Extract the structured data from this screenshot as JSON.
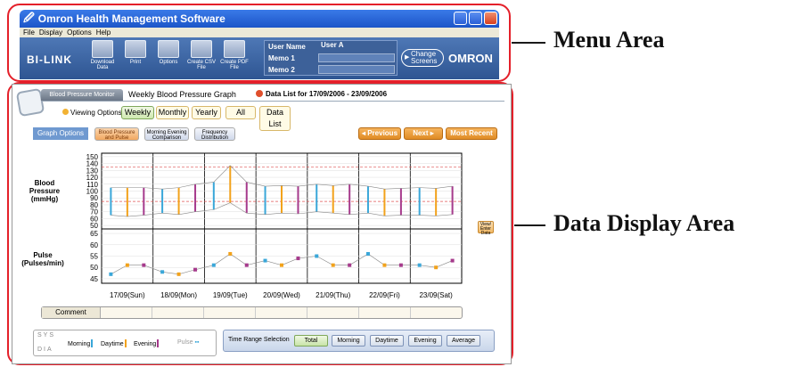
{
  "window": {
    "title": "Omron Health Management Software"
  },
  "menu": {
    "items": [
      "File",
      "Display",
      "Options",
      "Help"
    ]
  },
  "toolbar": {
    "logo": "BI-LINK",
    "buttons": [
      {
        "label": "Download Data",
        "icon": "download-icon"
      },
      {
        "label": "Print",
        "icon": "print-icon"
      },
      {
        "label": "Options",
        "icon": "options-icon"
      },
      {
        "label": "Create CSV File",
        "icon": "csv-file-icon"
      },
      {
        "label": "Create PDF File",
        "icon": "pdf-file-icon"
      }
    ],
    "user_name_label": "User Name",
    "user_name_value": "User A",
    "memo1_label": "Memo 1",
    "memo2_label": "Memo 2",
    "change_screens": "Change Screens",
    "brand": "OMRON"
  },
  "header": {
    "module_tab": "Blood Pressure Monitor",
    "graph_title": "Weekly Blood Pressure Graph",
    "data_list_range": "Data List for 17/09/2006 - 23/09/2006",
    "viewing_options": "Viewing Options",
    "view_tabs": [
      "Weekly",
      "Monthly",
      "Yearly",
      "All",
      "Data List"
    ]
  },
  "graph_options": {
    "label": "Graph Options",
    "buttons": [
      "Blood Pressure and Pulse",
      "Morning Evening Comparison",
      "Frequency Distribution"
    ],
    "nav": {
      "previous": "◂ Previous",
      "next": "Next ▸",
      "most_recent": "Most Recent ▸▸"
    }
  },
  "chart_data": {
    "type": "line",
    "bp_axis": {
      "label": "Blood Pressure (mmHg)",
      "ticks": [
        50,
        70,
        90,
        110,
        130,
        150
      ],
      "ylim": [
        45,
        155
      ]
    },
    "pulse_axis": {
      "label": "Pulse (Pulses/min)",
      "ticks": [
        45,
        50,
        55,
        60,
        65
      ],
      "ylim": [
        43,
        67
      ]
    },
    "categories": [
      "17/09(Sun)",
      "18/09(Mon)",
      "19/09(Tue)",
      "20/09(Wed)",
      "21/09(Thu)",
      "22/09(Fri)",
      "23/09(Sat)"
    ],
    "bp_readings": [
      {
        "day": 0,
        "slot": "Morning",
        "sys": 105,
        "dia": 65
      },
      {
        "day": 0,
        "slot": "Daytime",
        "sys": 105,
        "dia": 63
      },
      {
        "day": 0,
        "slot": "Evening",
        "sys": 105,
        "dia": 65
      },
      {
        "day": 1,
        "slot": "Morning",
        "sys": 103,
        "dia": 68
      },
      {
        "day": 1,
        "slot": "Daytime",
        "sys": 105,
        "dia": 66
      },
      {
        "day": 1,
        "slot": "Evening",
        "sys": 110,
        "dia": 70
      },
      {
        "day": 2,
        "slot": "Morning",
        "sys": 113,
        "dia": 73
      },
      {
        "day": 2,
        "slot": "Daytime",
        "sys": 137,
        "dia": 83
      },
      {
        "day": 2,
        "slot": "Evening",
        "sys": 113,
        "dia": 68
      },
      {
        "day": 3,
        "slot": "Morning",
        "sys": 107,
        "dia": 66
      },
      {
        "day": 3,
        "slot": "Daytime",
        "sys": 108,
        "dia": 68
      },
      {
        "day": 3,
        "slot": "Evening",
        "sys": 107,
        "dia": 67
      },
      {
        "day": 4,
        "slot": "Morning",
        "sys": 110,
        "dia": 70
      },
      {
        "day": 4,
        "slot": "Daytime",
        "sys": 108,
        "dia": 68
      },
      {
        "day": 4,
        "slot": "Evening",
        "sys": 110,
        "dia": 66
      },
      {
        "day": 5,
        "slot": "Morning",
        "sys": 107,
        "dia": 68
      },
      {
        "day": 5,
        "slot": "Daytime",
        "sys": 103,
        "dia": 64
      },
      {
        "day": 5,
        "slot": "Evening",
        "sys": 104,
        "dia": 65
      },
      {
        "day": 6,
        "slot": "Morning",
        "sys": 105,
        "dia": 65
      },
      {
        "day": 6,
        "slot": "Daytime",
        "sys": 104,
        "dia": 64
      },
      {
        "day": 6,
        "slot": "Evening",
        "sys": 107,
        "dia": 66
      }
    ],
    "pulse_readings": [
      {
        "day": 0,
        "slot": "Morning",
        "value": 47
      },
      {
        "day": 0,
        "slot": "Daytime",
        "value": 51
      },
      {
        "day": 0,
        "slot": "Evening",
        "value": 51
      },
      {
        "day": 1,
        "slot": "Morning",
        "value": 48
      },
      {
        "day": 1,
        "slot": "Daytime",
        "value": 47
      },
      {
        "day": 1,
        "slot": "Evening",
        "value": 49
      },
      {
        "day": 2,
        "slot": "Morning",
        "value": 51
      },
      {
        "day": 2,
        "slot": "Daytime",
        "value": 56
      },
      {
        "day": 2,
        "slot": "Evening",
        "value": 51
      },
      {
        "day": 3,
        "slot": "Morning",
        "value": 53
      },
      {
        "day": 3,
        "slot": "Daytime",
        "value": 51
      },
      {
        "day": 3,
        "slot": "Evening",
        "value": 54
      },
      {
        "day": 4,
        "slot": "Morning",
        "value": 55
      },
      {
        "day": 4,
        "slot": "Daytime",
        "value": 51
      },
      {
        "day": 4,
        "slot": "Evening",
        "value": 51
      },
      {
        "day": 5,
        "slot": "Morning",
        "value": 56
      },
      {
        "day": 5,
        "slot": "Daytime",
        "value": 51
      },
      {
        "day": 5,
        "slot": "Evening",
        "value": 51
      },
      {
        "day": 6,
        "slot": "Morning",
        "value": 51
      },
      {
        "day": 6,
        "slot": "Daytime",
        "value": 50
      },
      {
        "day": 6,
        "slot": "Evening",
        "value": 53
      }
    ],
    "reference_lines": [
      135,
      85
    ],
    "colors": {
      "Morning": "#3aa7d9",
      "Daytime": "#f2a21b",
      "Evening": "#a63a8c"
    }
  },
  "view_enter_data": "View/ Enter Data",
  "comment_label": "Comment",
  "legend": {
    "sys": "SYS",
    "dia": "DIA",
    "morning": "Morning",
    "daytime": "Daytime",
    "evening": "Evening",
    "pulse": "Pulse"
  },
  "time_range": {
    "label": "Time Range Selection",
    "buttons": [
      "Total",
      "Morning",
      "Daytime",
      "Evening",
      "Average"
    ]
  },
  "annotations": {
    "menu_area": "Menu Area",
    "data_area": "Data Display Area"
  }
}
